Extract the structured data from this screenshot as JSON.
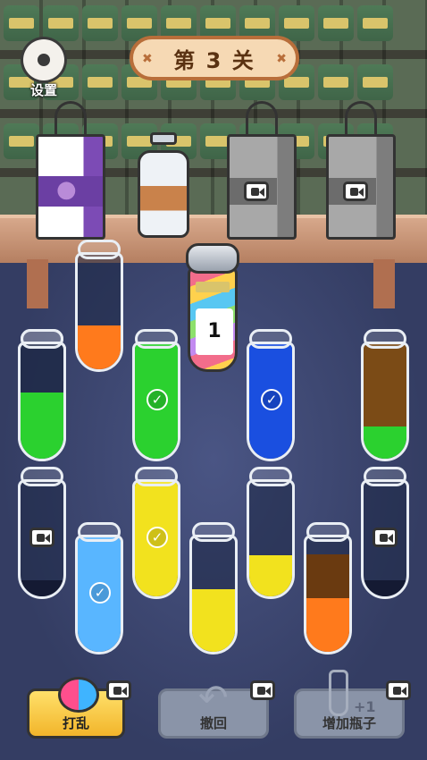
{
  "header": {
    "level_title": "第 3 关",
    "settings_label": "设置"
  },
  "shelf": {
    "items": [
      {
        "name": "grape-bag",
        "locked": false
      },
      {
        "name": "milk-bottle",
        "locked": false
      },
      {
        "name": "locked-bag-1",
        "locked": true,
        "icon": "video-icon"
      },
      {
        "name": "locked-bag-2",
        "locked": true,
        "icon": "video-icon"
      }
    ]
  },
  "magic_bottle": {
    "count": "1"
  },
  "tubes": [
    {
      "id": "t1",
      "fill": 0.0,
      "color": "#1f2b50",
      "check": false,
      "locked": false
    },
    {
      "id": "t2",
      "fill": 0.38,
      "color": "#ff7a1c",
      "check": false,
      "locked": false
    },
    {
      "id": "t3",
      "fill": 0.58,
      "color": "#2bd12f",
      "check": false,
      "locked": false
    },
    {
      "id": "t4",
      "fill": 1.0,
      "color": "#2bd12f",
      "check": true,
      "locked": false
    },
    {
      "id": "t5",
      "fill": 1.0,
      "color": "#1a4fe0",
      "check": true,
      "locked": false
    },
    {
      "id": "t6",
      "fill": 1.0,
      "color": "#7b4b16",
      "color2": "#2bd12f",
      "split": 0.28,
      "check": false,
      "locked": false
    },
    {
      "id": "t7",
      "fill": 0.0,
      "color": "#1f2b50",
      "check": false,
      "locked": true
    },
    {
      "id": "t8",
      "fill": 1.0,
      "color": "#59b6ff",
      "check": true,
      "locked": false
    },
    {
      "id": "t9",
      "fill": 1.0,
      "color": "#f2e21e",
      "check": true,
      "locked": false
    },
    {
      "id": "t10",
      "fill": 0.55,
      "color": "#f2e21e",
      "check": false,
      "locked": false
    },
    {
      "id": "t11",
      "fill": 0.36,
      "color": "#f2e21e",
      "check": false,
      "locked": false
    },
    {
      "id": "t12",
      "fill": 0.85,
      "color": "#6a3a10",
      "color2": "#ff7a1c",
      "split": 0.55,
      "check": false,
      "locked": false
    },
    {
      "id": "t13",
      "fill": 0.0,
      "color": "#1f2b50",
      "check": false,
      "locked": true
    }
  ],
  "toolbar": {
    "shuffle_label": "打乱",
    "undo_label": "撤回",
    "add_bottle_label": "增加瓶子",
    "add_bottle_badge": "+1"
  },
  "colors": {
    "background": "#3a4470",
    "banner": "#f6d9b4",
    "banner_border": "#b86e3a",
    "shuffle_button": "#f2b52b",
    "disabled_button": "#8a94a8"
  }
}
